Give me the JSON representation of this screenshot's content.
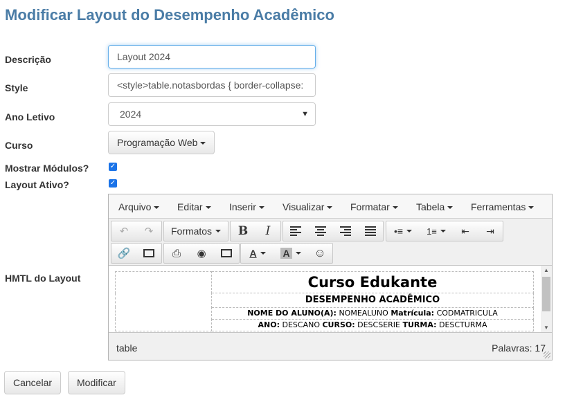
{
  "page": {
    "title": "Modificar Layout do Desempenho Acadêmico"
  },
  "form": {
    "descricao": {
      "label": "Descrição",
      "value": "Layout 2024"
    },
    "style": {
      "label": "Style",
      "value": "<style>table.notasbordas { border-collapse:"
    },
    "ano_letivo": {
      "label": "Ano Letivo",
      "value": "2024"
    },
    "curso": {
      "label": "Curso",
      "value": "Programação Web"
    },
    "mostrar_modulos": {
      "label": "Mostrar Módulos?",
      "checked": true
    },
    "layout_ativo": {
      "label": "Layout Ativo?",
      "checked": true
    },
    "html_layout": {
      "label": "HMTL do Layout"
    }
  },
  "editor": {
    "menu": [
      "Arquivo",
      "Editar",
      "Inserir",
      "Visualizar",
      "Formatar",
      "Tabela",
      "Ferramentas"
    ],
    "formats_label": "Formatos",
    "content": {
      "title": "Curso Edukante",
      "subtitle": "DESEMPENHO ACADÊMICO",
      "student_label": "NOME DO ALUNO(A):",
      "student_value": "NOMEALUNO",
      "matricula_label": "Matrícula:",
      "matricula_value": "CODMATRICULA",
      "ano_label": "ANO:",
      "ano_value": "DESCANO",
      "curso_label": "CURSO:",
      "curso_value": "DESCSERIE",
      "turma_label": "TURMA:",
      "turma_value": "DESCTURMA"
    },
    "status_path": "table",
    "word_count": "Palavras: 17"
  },
  "actions": {
    "cancel": "Cancelar",
    "submit": "Modificar"
  },
  "colors": {
    "title": "#4a7ca6",
    "checkbox": "#1a73e8",
    "focus": "#66afe9"
  }
}
